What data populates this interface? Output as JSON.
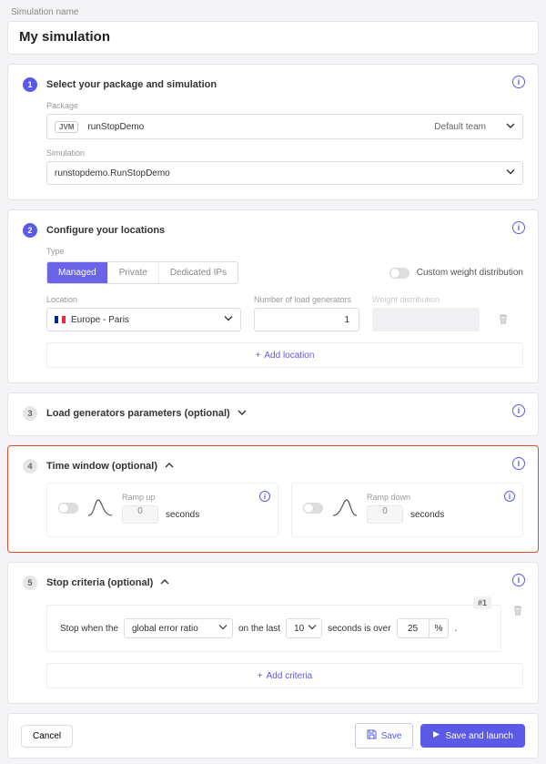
{
  "page": {
    "label": "Simulation name",
    "title": "My simulation"
  },
  "step1": {
    "title": "Select your package and simulation",
    "package_label": "Package",
    "jvm_tag": "JVM",
    "package_name": "runStopDemo",
    "team": "Default team",
    "simulation_label": "Simulation",
    "simulation_value": "runstopdemo.RunStopDemo"
  },
  "step2": {
    "title": "Configure your locations",
    "type_label": "Type",
    "tabs": [
      "Managed",
      "Private",
      "Dedicated IPs"
    ],
    "custom_weight_label": "Custom weight distribution",
    "location_label": "Location",
    "location_value": "Europe - Paris",
    "gen_label": "Number of load generators",
    "gen_value": "1",
    "wd_label": "Weight distribution",
    "add_location": "Add location"
  },
  "step3": {
    "title": "Load generators parameters (optional)"
  },
  "step4": {
    "title": "Time window (optional)",
    "ramp_up_label": "Ramp up",
    "ramp_down_label": "Ramp down",
    "zero": "0",
    "unit": "seconds"
  },
  "step5": {
    "title": "Stop criteria (optional)",
    "badge": "#1",
    "stop_when": "Stop when the",
    "metric": "global error ratio",
    "on_last": "on the last",
    "last_value": "10",
    "seconds_over": "seconds is over",
    "threshold": "25",
    "pct": "%",
    "dot": ".",
    "add_criteria": "Add criteria"
  },
  "footer": {
    "cancel": "Cancel",
    "save": "Save",
    "save_launch": "Save and launch"
  },
  "icons": {
    "info": "i",
    "plus": "+"
  }
}
